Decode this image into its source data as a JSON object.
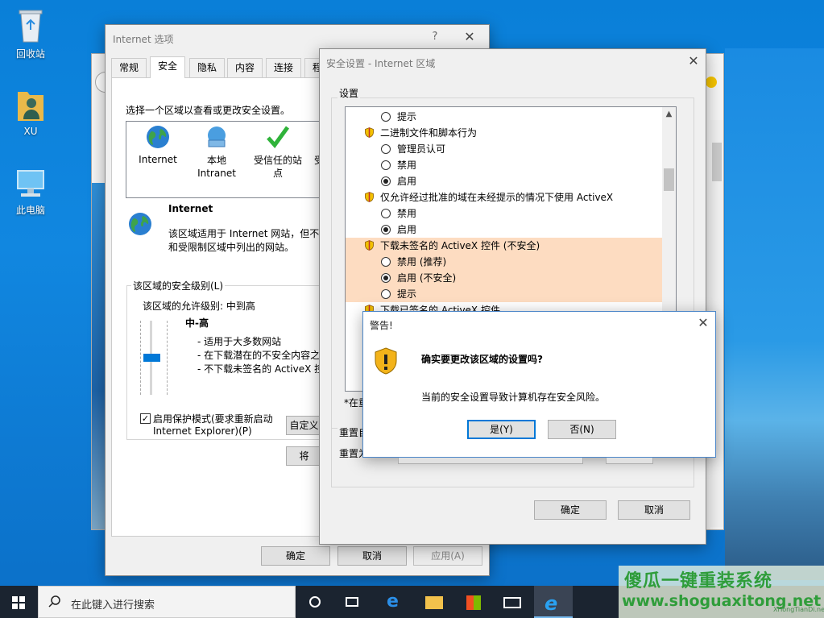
{
  "desktop": {
    "icons": [
      {
        "label": "回收站"
      },
      {
        "label": "XU"
      },
      {
        "label": "此电脑"
      }
    ]
  },
  "inet_options": {
    "title": "Internet 选项",
    "help": "?",
    "tabs": [
      "常规",
      "安全",
      "隐私",
      "内容",
      "连接",
      "程"
    ],
    "instruction": "选择一个区域以查看或更改安全设置。",
    "zones": [
      {
        "label": "Internet"
      },
      {
        "label": "本地\nIntranet"
      },
      {
        "label": "受信任的站\n点"
      },
      {
        "label": "受"
      }
    ],
    "zone_title": "Internet",
    "zone_desc_1": "该区域适用于 Internet 网站，但不",
    "zone_desc_2": "和受限制区域中列出的网站。",
    "level_group": "该区域的安全级别(L)",
    "allowed_level": "该区域的允许级别: 中到高",
    "level_name": "中-高",
    "level_points": [
      "- 适用于大多数网站",
      "- 在下载潜在的不安全内容之",
      "- 不下载未签名的 ActiveX 控"
    ],
    "protected_mode_1": "启用保护模式(要求重新启动",
    "protected_mode_2": "Internet Explorer)(P)",
    "custom_btn": "自定义",
    "default_btn": "将",
    "ok": "确定",
    "cancel": "取消",
    "apply": "应用(A)"
  },
  "security_settings": {
    "title": "安全设置 - Internet 区域",
    "settings_label": "设置",
    "items": [
      {
        "kind": "radio",
        "label": "提示",
        "checked": false
      },
      {
        "kind": "head",
        "label": "二进制文件和脚本行为"
      },
      {
        "kind": "radio",
        "label": "管理员认可",
        "checked": false
      },
      {
        "kind": "radio",
        "label": "禁用",
        "checked": false
      },
      {
        "kind": "radio",
        "label": "启用",
        "checked": true
      },
      {
        "kind": "head",
        "label": "仅允许经过批准的域在未经提示的情况下使用 ActiveX"
      },
      {
        "kind": "radio",
        "label": "禁用",
        "checked": false
      },
      {
        "kind": "radio",
        "label": "启用",
        "checked": true
      },
      {
        "kind": "head",
        "label": "下载未签名的 ActiveX 控件 (不安全)",
        "highlight": true
      },
      {
        "kind": "radio",
        "label": "禁用 (推荐)",
        "checked": false,
        "highlight": true
      },
      {
        "kind": "radio",
        "label": "启用 (不安全)",
        "checked": true,
        "highlight": true
      },
      {
        "kind": "radio",
        "label": "提示",
        "checked": false,
        "highlight": true
      },
      {
        "kind": "head",
        "label": "下载已签名的 ActiveX 控件"
      }
    ],
    "footnote": "*在重",
    "reset_group": "重置自",
    "reset_to": "重置为",
    "ok": "确定",
    "cancel": "取消"
  },
  "warning": {
    "title": "警告!",
    "question": "确实要更改该区域的设置吗?",
    "detail": "当前的安全设置导致计算机存在安全风险。",
    "yes": "是(Y)",
    "no": "否(N)"
  },
  "taskbar": {
    "search_placeholder": "在此键入进行搜索"
  },
  "watermark": {
    "line1": "傻瓜一键重装系统",
    "line2": "www.shoguaxitong.net",
    "small": "XiTongTianDi.net"
  }
}
